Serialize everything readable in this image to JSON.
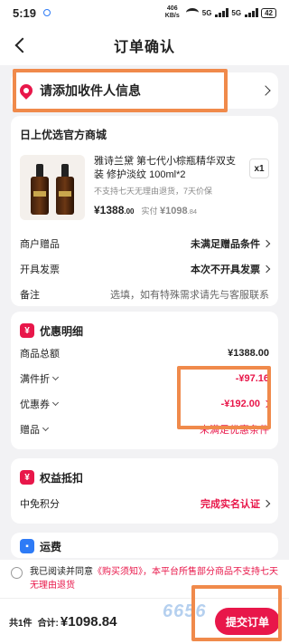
{
  "status": {
    "time": "5:19",
    "net": "406 KB/s",
    "sig1": "5G",
    "sig2": "5G",
    "battery": "42"
  },
  "nav": {
    "title": "订单确认"
  },
  "address": {
    "label": "请添加收件人信息"
  },
  "shop": {
    "name": "日上优选官方商城",
    "product": {
      "title": "雅诗兰黛 第七代小棕瓶精华双支装 修护淡纹 100ml*2",
      "note": "不支持七天无理由退货，7天价保",
      "price": "¥1388",
      "price_cents": ".00",
      "real_label": "实付",
      "real_price": "¥1098",
      "real_cents": ".84",
      "qty": "x1"
    },
    "rows": [
      {
        "label": "商户赠品",
        "value": "未满足赠品条件"
      },
      {
        "label": "开具发票",
        "value": "本次不开具发票"
      },
      {
        "label": "备注",
        "value": "选填，如有特殊需求请先与客服联系"
      }
    ]
  },
  "discount": {
    "title": "优惠明细",
    "icon_text": "¥",
    "rows": [
      {
        "label": "商品总额",
        "value": "¥1388.00"
      },
      {
        "label": "满件折",
        "value": "-¥97.16"
      },
      {
        "label": "优惠券",
        "value": "-¥192.00"
      },
      {
        "label": "赠品",
        "value": "未满足优惠条件"
      }
    ]
  },
  "rights": {
    "title": "权益抵扣",
    "icon_text": "¥",
    "row": {
      "label": "中免积分",
      "value": "完成实名认证"
    }
  },
  "shipping": {
    "title": "运费"
  },
  "agreement": {
    "prefix": "我已阅读并同意",
    "link": "《购买须知》",
    "suffix": "，本平台所售部分商品不支持七天无理由退货"
  },
  "bottom": {
    "count": "共1件",
    "total_label": "合计:",
    "total_value": "¥1098.84",
    "submit_label": "提交订单"
  },
  "watermark": "6656",
  "colors": {
    "accent": "#e8174a",
    "highlight": "#f08a4b",
    "background": "#f2f2f4"
  }
}
